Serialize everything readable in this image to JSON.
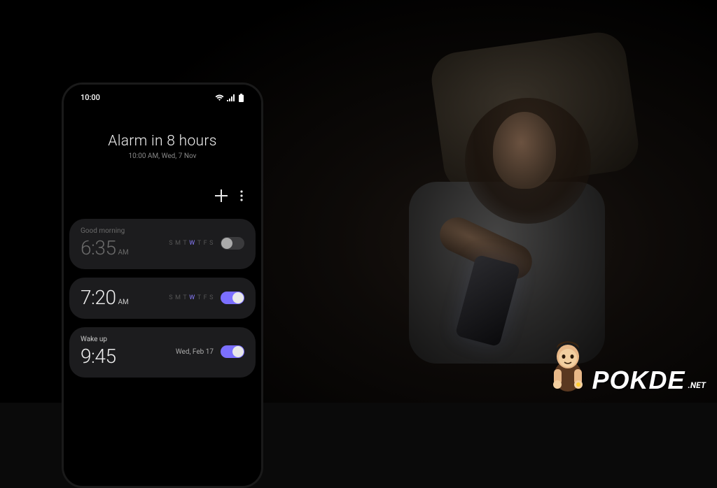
{
  "status_bar": {
    "time": "10:00"
  },
  "header": {
    "title": "Alarm in 8 hours",
    "subtitle": "10:00 AM, Wed, 7 Nov"
  },
  "days": [
    "S",
    "M",
    "T",
    "W",
    "T",
    "F",
    "S"
  ],
  "alarms": [
    {
      "label": "Good morning",
      "time": "6:35",
      "ampm": "AM",
      "active_days": [
        3
      ],
      "enabled": false
    },
    {
      "label": "",
      "time": "7:20",
      "ampm": "AM",
      "active_days": [
        3
      ],
      "enabled": true
    },
    {
      "label": "Wake up",
      "time": "9:45",
      "ampm": "",
      "date": "Wed, Feb 17",
      "enabled": true
    }
  ],
  "branding": {
    "name": "POKDE",
    "tld": ".NET"
  }
}
